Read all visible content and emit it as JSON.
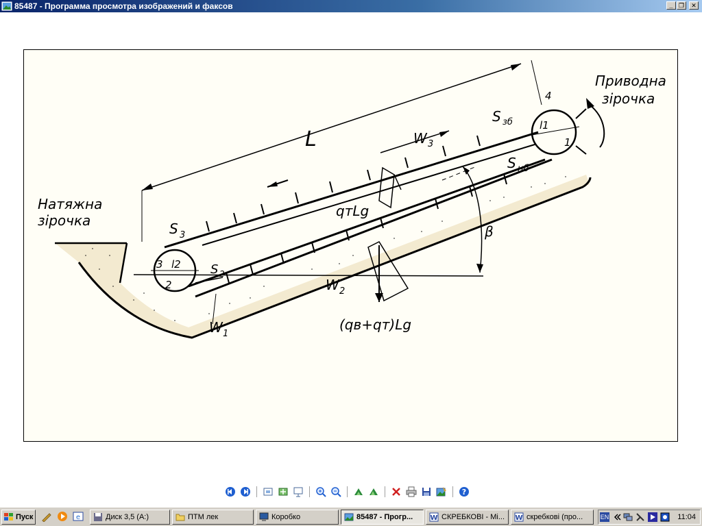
{
  "window": {
    "title": "85487 - Программа просмотра изображений и факсов"
  },
  "drawing": {
    "label_tension_line1": "Натяжна",
    "label_tension_line2": "зірочка",
    "label_drive_line1": "Приводна",
    "label_drive_line2": "зірочка",
    "length": "L",
    "s3": "S",
    "s3_sub": "3",
    "s2": "S",
    "s2_sub": "2",
    "s_zb": "S",
    "s_zb_sub": "зб",
    "s_nb": "S",
    "s_nb_sub": "нб",
    "w1": "W",
    "w1_sub": "1",
    "w2": "W",
    "w2_sub": "2",
    "w3": "W",
    "w3_sub": "3",
    "qt_lg": "qтLg",
    "q_sum": "(qв+qт)Lg",
    "beta": "β",
    "n1": "1",
    "n2": "2",
    "n3": "3",
    "n4": "4",
    "l1": "l1",
    "l2": "l2"
  },
  "toolbar": {
    "icons": [
      "prev-image-icon",
      "next-image-icon",
      "best-fit-icon",
      "actual-size-icon",
      "slideshow-icon",
      "zoom-in-icon",
      "zoom-out-icon",
      "rotate-clockwise-icon",
      "rotate-counterclockwise-icon",
      "delete-icon",
      "print-icon",
      "save-icon",
      "open-editor-icon",
      "help-icon"
    ]
  },
  "taskbar": {
    "start_label": "Пуск",
    "tasks": [
      {
        "label": "Диск 3,5 (A:)",
        "icon": "floppy-drive-icon"
      },
      {
        "label": "ПТМ лек",
        "icon": "folder-icon"
      },
      {
        "label": "Коробко",
        "icon": "computer-icon"
      },
      {
        "label": "85487 - Прогр...",
        "icon": "image-viewer-icon",
        "active": true
      },
      {
        "label": "СКРЕБКОВІ - Mi...",
        "icon": "word-icon"
      },
      {
        "label": "скребкові (про...",
        "icon": "word-icon"
      }
    ],
    "language": "EN",
    "clock": "11:04"
  }
}
